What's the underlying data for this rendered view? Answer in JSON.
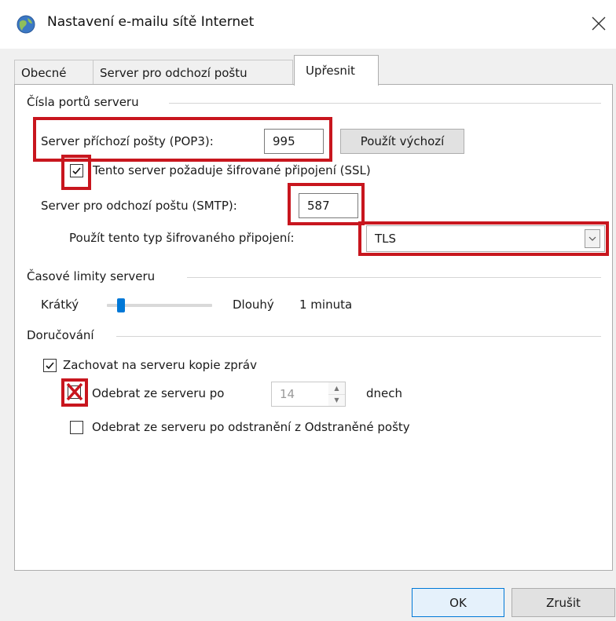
{
  "window": {
    "title": "Nastavení e-mailu sítě Internet",
    "close_icon": "close-icon"
  },
  "tabs": [
    {
      "label": "Obecné",
      "active": false
    },
    {
      "label": "Server pro odchozí poštu",
      "active": false
    },
    {
      "label": "Upřesnit",
      "active": true
    }
  ],
  "ports": {
    "group_title": "Čísla portů serveru",
    "pop3_label": "Server příchozí pošty (POP3):",
    "pop3_value": "995",
    "use_default_label": "Použít výchozí",
    "ssl_label": "Tento server požaduje šifrované připojení (SSL)",
    "ssl_checked": true,
    "smtp_label": "Server pro odchozí poštu (SMTP):",
    "smtp_value": "587",
    "encryption_label": "Použít tento typ šifrovaného připojení:",
    "encryption_value": "TLS"
  },
  "timeouts": {
    "group_title": "Časové limity serveru",
    "short_label": "Krátký",
    "long_label": "Dlouhý",
    "value_text": "1 minuta",
    "slider_level": 0.1
  },
  "delivery": {
    "group_title": "Doručování",
    "keep_copies_label": "Zachovat na serveru kopie zpráv",
    "keep_copies_checked": true,
    "remove_after_label": "Odebrat ze serveru po",
    "remove_after_checked": false,
    "remove_after_days": "14",
    "days_label": "dnech",
    "remove_on_delete_label": "Odebrat ze serveru po odstranění z Odstraněné pošty",
    "remove_on_delete_checked": false
  },
  "footer": {
    "ok_label": "OK",
    "cancel_label": "Zrušit"
  },
  "colors": {
    "highlight": "#c8161e",
    "accent": "#0078d7"
  }
}
